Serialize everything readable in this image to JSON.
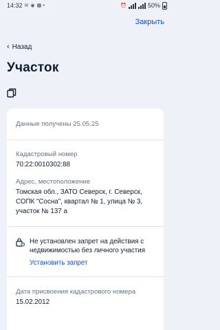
{
  "status": {
    "time": "14:32",
    "battery": "50%"
  },
  "header": {
    "close_label": "Закрыть",
    "back_label": "Назад",
    "title": "Участок"
  },
  "card": {
    "received": "Данные получены 25.05.25",
    "cadastral": {
      "label": "Кадастровый номер",
      "value": "70:22:0010302:88"
    },
    "address": {
      "label": "Адрес, местоположение",
      "lines": [
        "Томская обл., ЗАТО Северск, г. Северск,",
        "СОПК \"Сосна\", квартал № 1, улица № 3,",
        "участок № 137 а"
      ]
    },
    "ban": {
      "lines": [
        "Не установлен запрет на действия с",
        "недвижимостью без личного участия"
      ],
      "link_label": "Установить запрет"
    },
    "assign_date": {
      "label": "Дата присвоения кадастрового номера",
      "value": "15.02.2012"
    }
  },
  "colors": {
    "accent": "#0d4cd3",
    "background": "#eef1f7",
    "card": "#ffffff",
    "muted_text": "#66727f"
  },
  "icons": [
    "chevron-left-icon",
    "copy-icon",
    "lock-info-icon"
  ]
}
